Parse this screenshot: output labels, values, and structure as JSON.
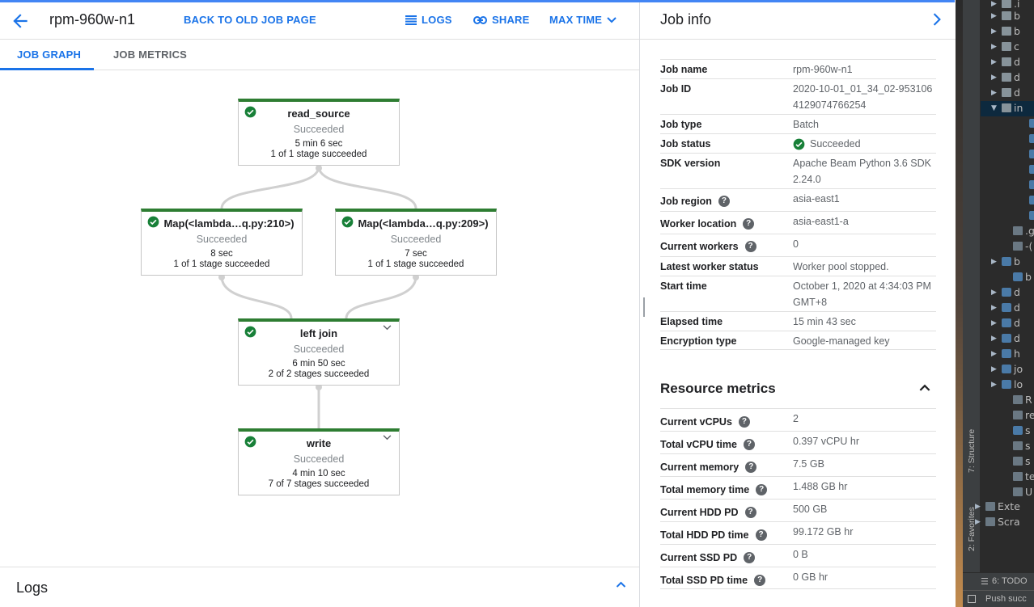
{
  "header": {
    "job_title": "rpm-960w-n1",
    "back_old": "BACK TO OLD JOB PAGE",
    "logs": "LOGS",
    "share": "SHARE",
    "max_time": "MAX TIME"
  },
  "tabs": [
    {
      "label": "JOB GRAPH",
      "active": true
    },
    {
      "label": "JOB METRICS",
      "active": false
    }
  ],
  "graph": {
    "nodes": [
      {
        "name": "read_source",
        "status": "Succeeded",
        "time": "5 min 6 sec",
        "stages": "1 of 1 stage succeeded"
      },
      {
        "name": "Map(<lambda…q.py:210>)",
        "status": "Succeeded",
        "time": "8 sec",
        "stages": "1 of 1 stage succeeded"
      },
      {
        "name": "Map(<lambda…q.py:209>)",
        "status": "Succeeded",
        "time": "7 sec",
        "stages": "1 of 1 stage succeeded"
      },
      {
        "name": "left join",
        "status": "Succeeded",
        "time": "6 min 50 sec",
        "stages": "2 of 2 stages succeeded"
      },
      {
        "name": "write",
        "status": "Succeeded",
        "time": "4 min 10 sec",
        "stages": "7 of 7 stages succeeded"
      }
    ]
  },
  "logs_panel": {
    "title": "Logs"
  },
  "job_info": {
    "title": "Job info",
    "rows": [
      {
        "key": "Job name",
        "value": "rpm-960w-n1"
      },
      {
        "key": "Job ID",
        "value": "2020-10-01_01_34_02-9531064129074766254"
      },
      {
        "key": "Job type",
        "value": "Batch"
      },
      {
        "key": "Job status",
        "value": "Succeeded"
      },
      {
        "key": "SDK version",
        "value": "Apache Beam Python 3.6 SDK 2.24.0"
      },
      {
        "key": "Job region",
        "value": "asia-east1"
      },
      {
        "key": "Worker location",
        "value": "asia-east1-a"
      },
      {
        "key": "Current workers",
        "value": "0"
      },
      {
        "key": "Latest worker status",
        "value": "Worker pool stopped."
      },
      {
        "key": "Start time",
        "value": "October 1, 2020 at 4:34:03 PM GMT+8"
      },
      {
        "key": "Elapsed time",
        "value": "15 min 43 sec"
      },
      {
        "key": "Encryption type",
        "value": "Google-managed key"
      }
    ]
  },
  "resource_metrics": {
    "title": "Resource metrics",
    "rows": [
      {
        "key": "Current vCPUs",
        "value": "2"
      },
      {
        "key": "Total vCPU time",
        "value": "0.397 vCPU hr"
      },
      {
        "key": "Current memory",
        "value": "7.5 GB"
      },
      {
        "key": "Total memory time",
        "value": "1.488 GB hr"
      },
      {
        "key": "Current HDD PD",
        "value": "500 GB"
      },
      {
        "key": "Total HDD PD time",
        "value": "99.172 GB hr"
      },
      {
        "key": "Current SSD PD",
        "value": "0 B"
      },
      {
        "key": "Total SSD PD time",
        "value": "0 GB hr"
      }
    ]
  },
  "ide": {
    "tree": [
      ".i",
      "b",
      "b",
      "c",
      "d",
      "d",
      "d",
      "in",
      "",
      "",
      "",
      "",
      "",
      "",
      "",
      ".g",
      "-(",
      "b",
      "b",
      "d",
      "d",
      "d",
      "d",
      "h",
      "jo",
      "lo",
      "R",
      "re",
      "s",
      "s",
      "s",
      "te",
      "U",
      "Exte",
      "Scra"
    ],
    "structure_tab": "7: Structure",
    "favorites_tab": "2: Favorites",
    "todo": "6: TODO",
    "status": "Push succ"
  },
  "colors": {
    "accent": "#1a73e8",
    "success": "#188038",
    "node_border_top": "#2e7d32"
  }
}
